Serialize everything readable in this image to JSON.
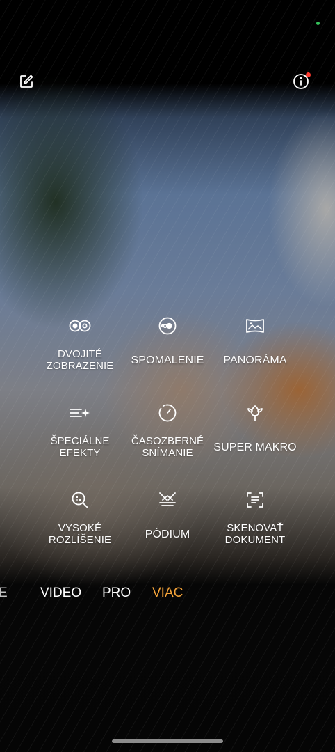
{
  "modes": [
    {
      "label": "DVOJITÉ\nZOBRAZENIE",
      "icon": "dual-view-icon"
    },
    {
      "label": "SPOMALENIE",
      "icon": "slow-motion-icon"
    },
    {
      "label": "PANORÁMA",
      "icon": "panorama-icon"
    },
    {
      "label": "ŠPECIÁLNE\nEFEKTY",
      "icon": "special-effects-icon"
    },
    {
      "label": "ČASOZBERNÉ\nSNÍMANIE",
      "icon": "timelapse-icon"
    },
    {
      "label": "SUPER MAKRO",
      "icon": "super-macro-icon"
    },
    {
      "label": "VYSOKÉ\nROZLÍŠENIE",
      "icon": "high-resolution-icon"
    },
    {
      "label": "PÓDIUM",
      "icon": "stage-icon"
    },
    {
      "label": "SKENOVAŤ\nDOKUMENT",
      "icon": "scan-document-icon"
    }
  ],
  "mode_bar": {
    "partial": "E",
    "tabs": [
      "VIDEO",
      "PRO",
      "VIAC"
    ],
    "active": "VIAC"
  },
  "colors": {
    "accent": "#f7a53a",
    "badge": "#ff3b30",
    "status_dot": "#35c15a"
  },
  "top_bar": {
    "left_icon": "edit-icon",
    "right_icon": "info-icon"
  }
}
